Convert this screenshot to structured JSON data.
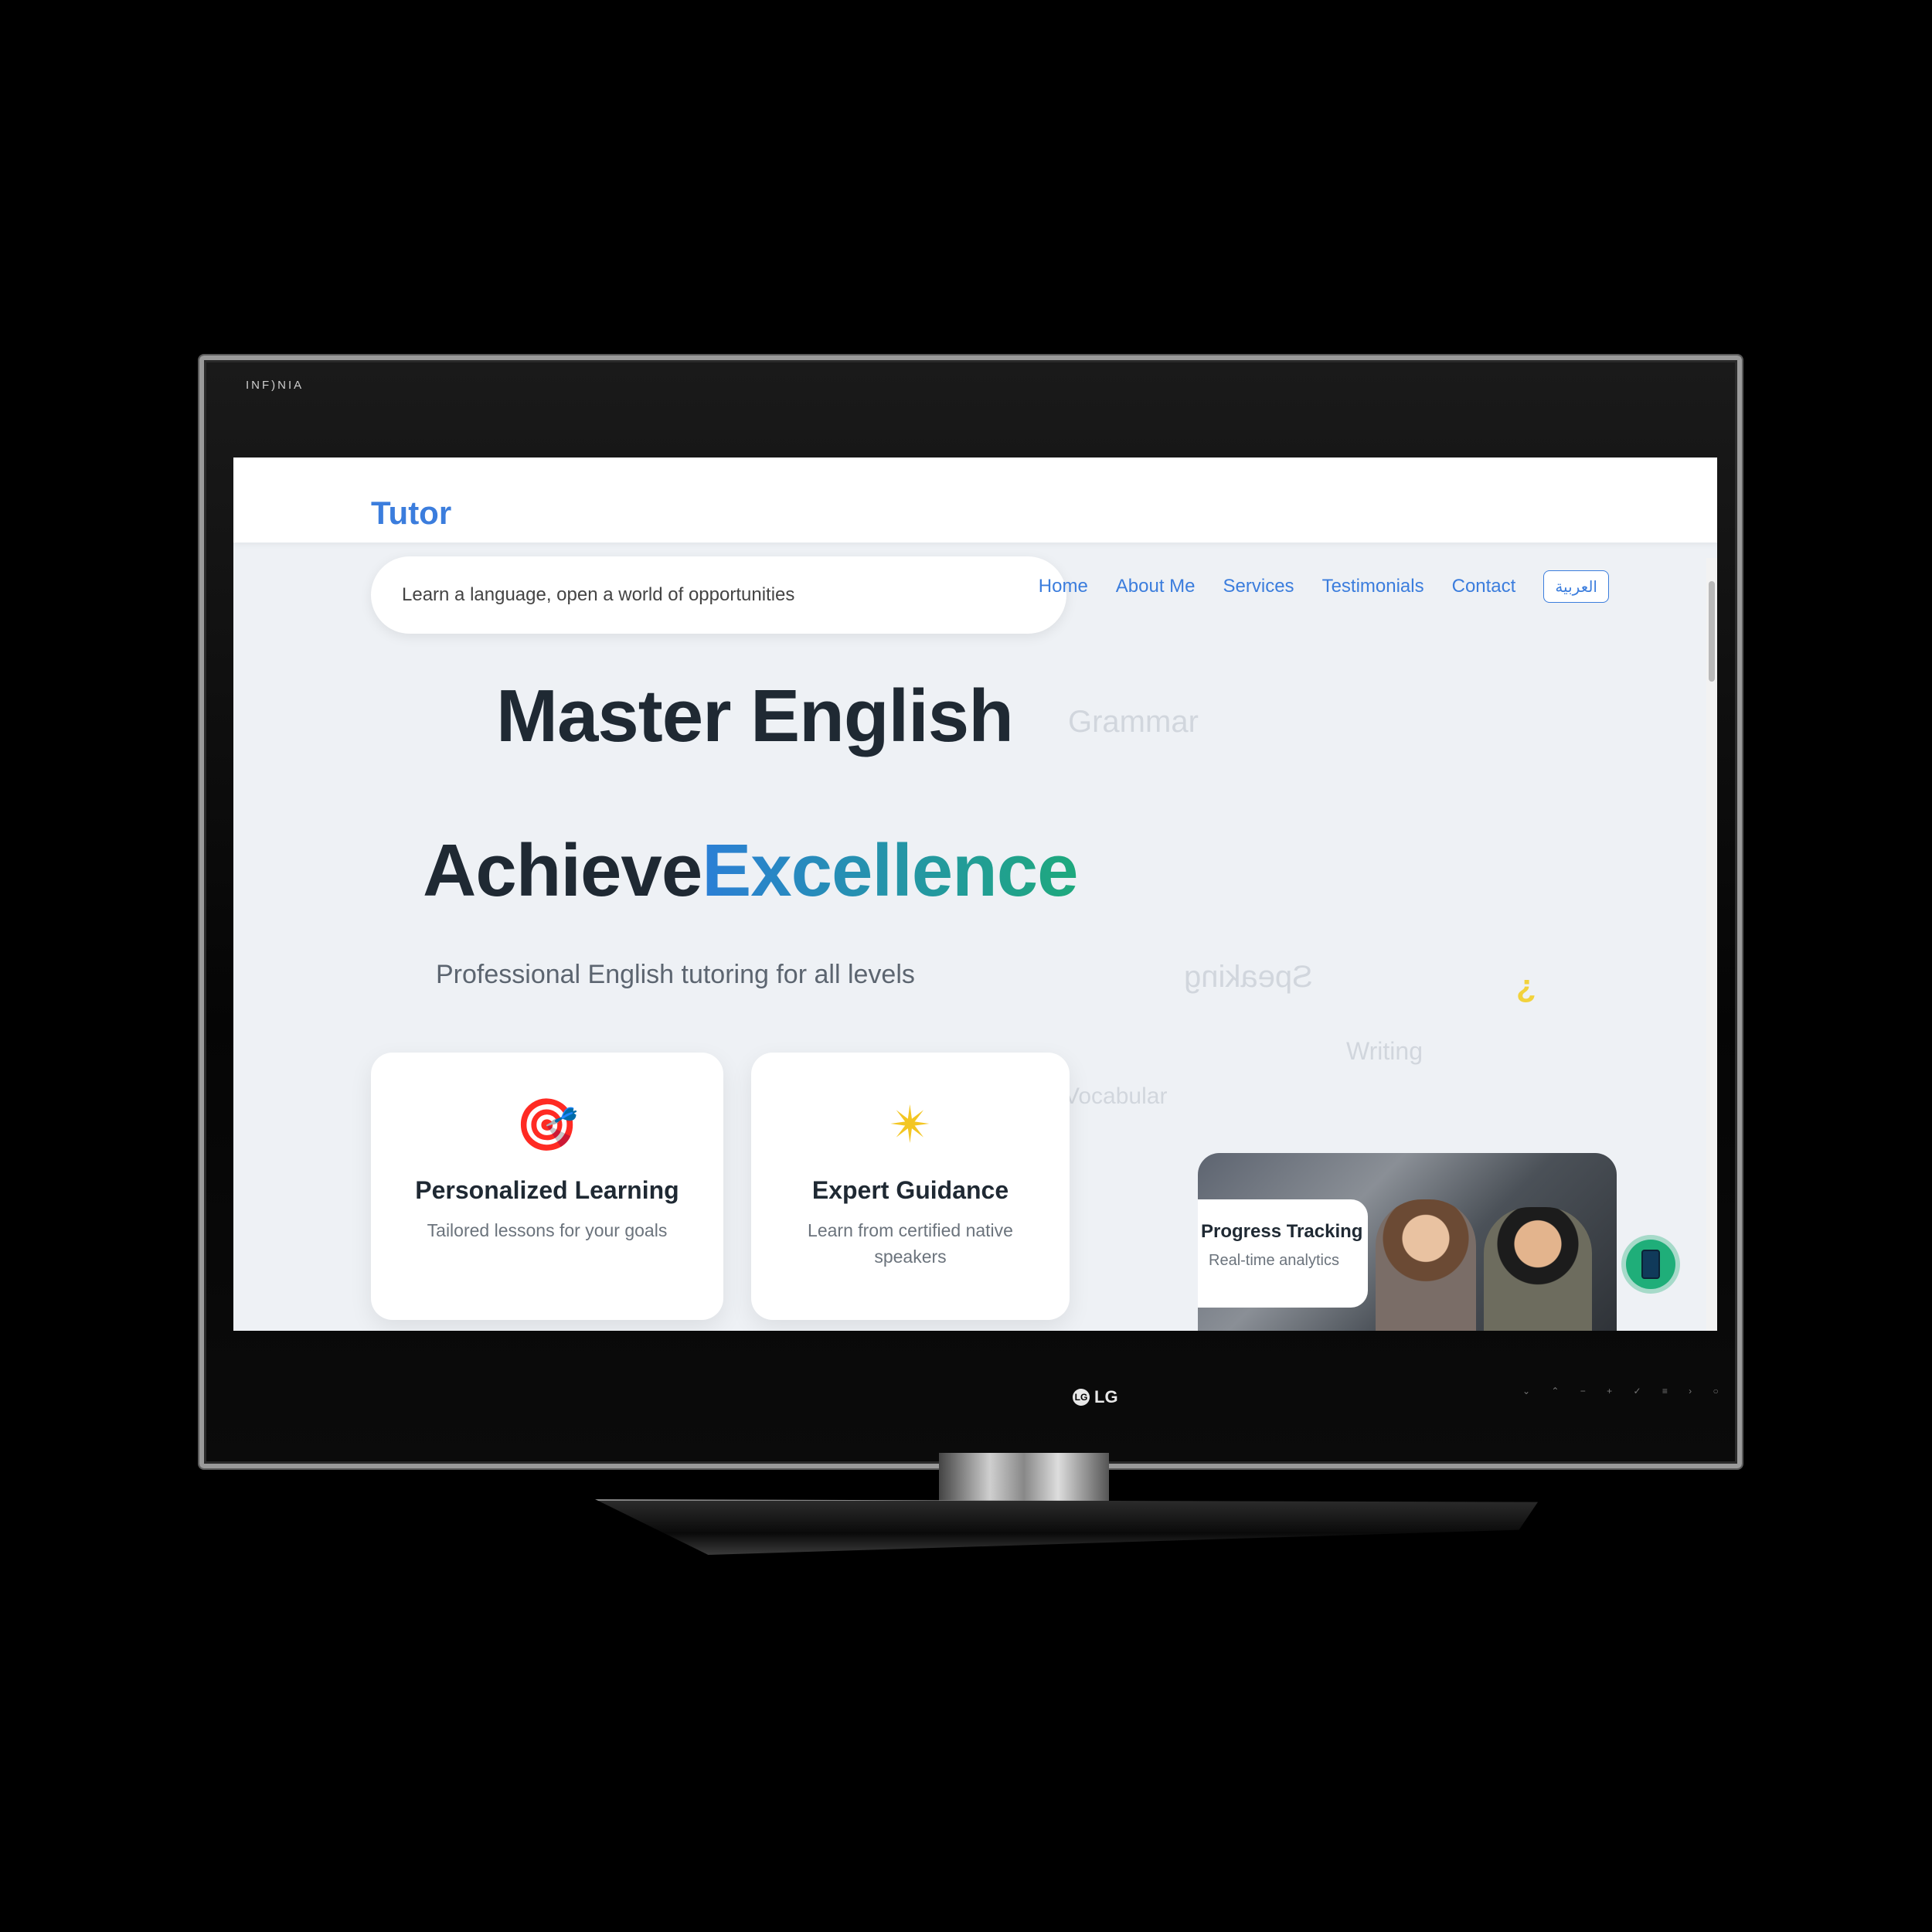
{
  "device": {
    "top_brand": "INF)NIA",
    "logo": "LG",
    "logo_mark": "LG",
    "buttons": "⌄ ⌃ − + ✓ ≡ › ○"
  },
  "site": {
    "brand": "Tutor",
    "tagline": "Learn a language, open a world of opportunities",
    "nav": {
      "items": [
        "Home",
        "About Me",
        "Services",
        "Testimonials",
        "Contact"
      ],
      "language_button": "العربية"
    },
    "hero": {
      "title": "Master English",
      "subtitle_part1": "Achieve",
      "subtitle_part2": "Excellence",
      "description": "Professional English tutoring for all levels"
    },
    "floating_words": {
      "grammar": "Grammar",
      "speaking": "Speaking",
      "writing": "Writing",
      "vocabulary": "Vocabular"
    },
    "cards": [
      {
        "icon": "target-icon",
        "glyph": "🎯",
        "title": "Personalized Learning",
        "desc": "Tailored lessons for your goals"
      },
      {
        "icon": "star-icon",
        "glyph": "✴",
        "title": "Expert Guidance",
        "desc": "Learn from certified native speakers"
      }
    ],
    "progress": {
      "title": "Progress Tracking",
      "desc": "Real-time analytics"
    }
  },
  "colors": {
    "brand": "#3b7ddd",
    "accent_gradient_start": "#2b7fd6",
    "accent_gradient_end": "#1ea97c",
    "cta_green": "#1fae79"
  }
}
